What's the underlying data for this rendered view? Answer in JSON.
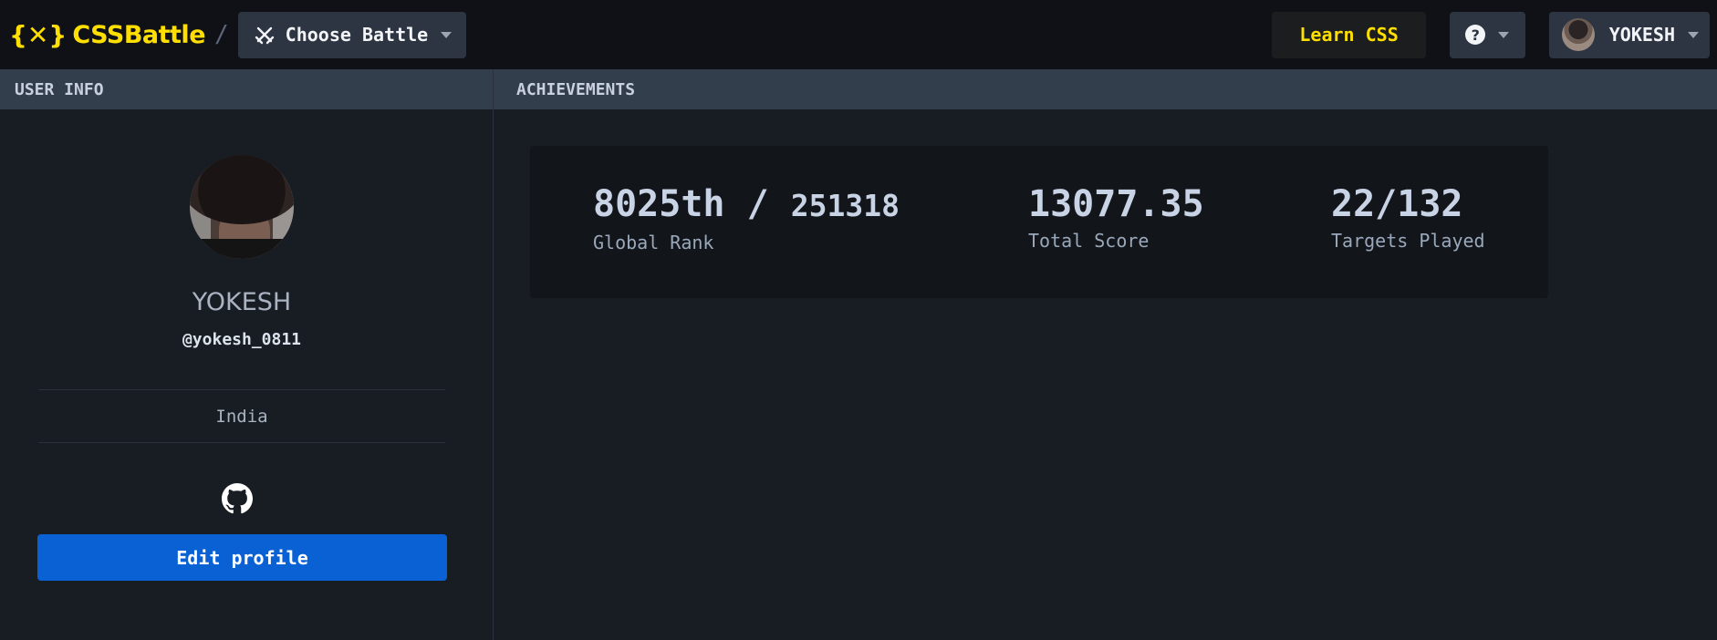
{
  "nav": {
    "logo_mark": "{✕}",
    "logo_text": "CSSBattle",
    "breadcrumb_separator": "/",
    "choose_battle_label": "Choose Battle",
    "learn_css_label": "Learn CSS",
    "help_label": "?",
    "user_label": "YOKESH"
  },
  "panels": {
    "user_info_title": "USER INFO",
    "achievements_title": "ACHIEVEMENTS"
  },
  "profile": {
    "display_name": "YOKESH",
    "username": "@yokesh_0811",
    "country": "India",
    "edit_button_label": "Edit profile",
    "social_icon": "github-icon"
  },
  "achievements": {
    "rank": "8025th /",
    "rank_total": "251318",
    "rank_label": "Global Rank",
    "score": "13077.35",
    "score_label": "Total Score",
    "targets": "22/132",
    "targets_label": "Targets Played"
  },
  "colors": {
    "brand_yellow": "#ffdf00",
    "primary_blue": "#0961d3",
    "topbar_bg": "#0f1116",
    "page_bg": "#181c23",
    "panel_head_bg": "#333e4c"
  }
}
